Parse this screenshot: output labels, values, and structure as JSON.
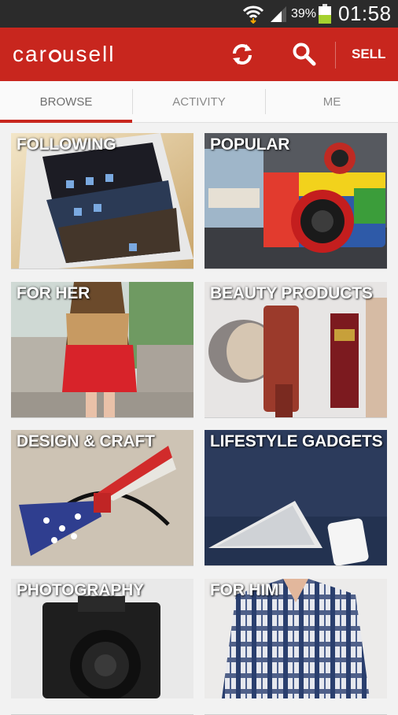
{
  "status_bar": {
    "battery_percent": "39%",
    "time": "01:58"
  },
  "app_bar": {
    "logo": "carousell",
    "sell_label": "SELL",
    "refresh_icon": "refresh-icon",
    "search_icon": "search-icon"
  },
  "tabs": [
    {
      "label": "BROWSE",
      "selected": true
    },
    {
      "label": "ACTIVITY",
      "selected": false
    },
    {
      "label": "ME",
      "selected": false
    }
  ],
  "categories": [
    {
      "label": "FOLLOWING"
    },
    {
      "label": "POPULAR"
    },
    {
      "label": "FOR HER"
    },
    {
      "label": "BEAUTY PRODUCTS"
    },
    {
      "label": "DESIGN & CRAFT"
    },
    {
      "label": "LIFESTYLE GADGETS"
    },
    {
      "label": "PHOTOGRAPHY"
    },
    {
      "label": "FOR HIM"
    }
  ],
  "colors": {
    "brand": "#c8261e",
    "status_bar": "#2b2b2b",
    "battery": "#a5d12f"
  }
}
